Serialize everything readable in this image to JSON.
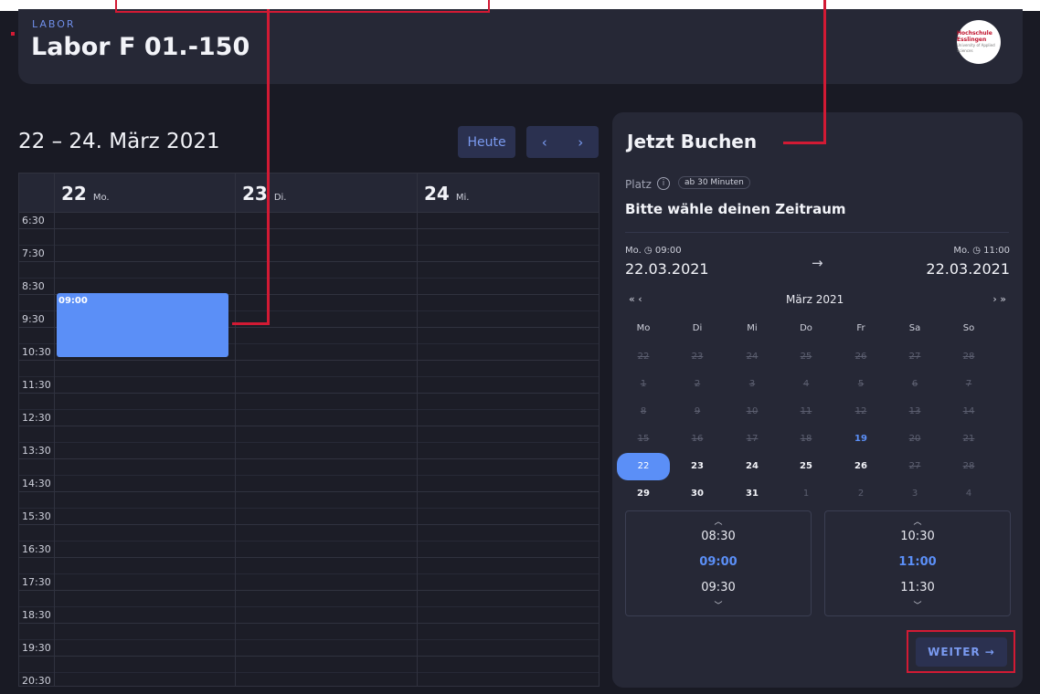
{
  "header": {
    "kicker": "LABOR",
    "title": "Labor F 01.-150",
    "logo_line1": "Hochschule Esslingen",
    "logo_line2": "University of Applied Sciences"
  },
  "calendar": {
    "title": "22 – 24. März 2021",
    "today_label": "Heute",
    "prev_icon": "‹",
    "next_icon": "›",
    "days": [
      {
        "num": "22",
        "name": "Mo."
      },
      {
        "num": "23",
        "name": "Di."
      },
      {
        "num": "24",
        "name": "Mi."
      }
    ],
    "times": [
      "6:30",
      "7:30",
      "8:30",
      "9:30",
      "10:30",
      "11:30",
      "12:30",
      "13:30",
      "14:30",
      "15:30",
      "16:30",
      "17:30",
      "18:30",
      "19:30",
      "20:30"
    ],
    "event": {
      "label": "09:00",
      "color": "#5b8ff7"
    }
  },
  "booking": {
    "title": "Jetzt Buchen",
    "platz_label": "Platz",
    "info_icon": "i",
    "duration_badge": "ab 30 Minuten",
    "subtitle": "Bitte wähle deinen Zeitraum",
    "start_label": "Mo. ◷ 09:00",
    "start_date": "22.03.2021",
    "end_label": "Mo. ◷ 11:00",
    "end_date": "22.03.2021",
    "arrow": "→",
    "month_nav_prev": "«  ‹",
    "month_name": "März  2021",
    "month_nav_next": "›  »",
    "weekdays": [
      "Mo",
      "Di",
      "Mi",
      "Do",
      "Fr",
      "Sa",
      "So"
    ],
    "weeks": [
      [
        "22",
        "23",
        "24",
        "25",
        "26",
        "27",
        "28"
      ],
      [
        "1",
        "2",
        "3",
        "4",
        "5",
        "6",
        "7"
      ],
      [
        "8",
        "9",
        "10",
        "11",
        "12",
        "13",
        "14"
      ],
      [
        "15",
        "16",
        "17",
        "18",
        "19",
        "20",
        "21"
      ],
      [
        "22",
        "23",
        "24",
        "25",
        "26",
        "27",
        "28"
      ],
      [
        "29",
        "30",
        "31",
        "1",
        "2",
        "3",
        "4"
      ]
    ],
    "start_times": [
      "08:30",
      "09:00",
      "09:30"
    ],
    "end_times": [
      "10:30",
      "11:00",
      "11:30"
    ],
    "weiter_label": "WEITER →",
    "accent_color": "#5b8ff7",
    "annotation_color": "#d21a34"
  }
}
